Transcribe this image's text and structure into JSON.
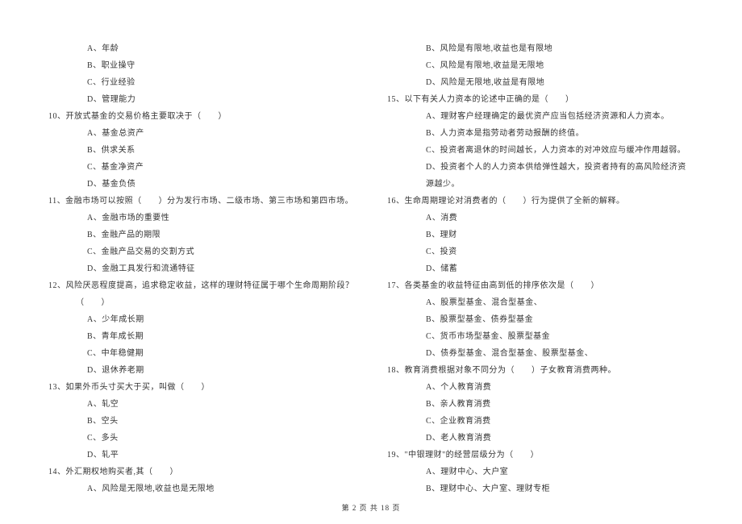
{
  "left_column": {
    "items": [
      {
        "type": "option",
        "text": "A、年龄"
      },
      {
        "type": "option",
        "text": "B、职业操守"
      },
      {
        "type": "option",
        "text": "C、行业经验"
      },
      {
        "type": "option",
        "text": "D、管理能力"
      },
      {
        "type": "question",
        "text": "10、开放式基金的交易价格主要取决于（　　）"
      },
      {
        "type": "option",
        "text": "A、基金总资产"
      },
      {
        "type": "option",
        "text": "B、供求关系"
      },
      {
        "type": "option",
        "text": "C、基金净资产"
      },
      {
        "type": "option",
        "text": "D、基金负债"
      },
      {
        "type": "question",
        "text": "11、金融市场可以按照（　　）分为发行市场、二级市场、第三市场和第四市场。"
      },
      {
        "type": "option",
        "text": "A、金融市场的重要性"
      },
      {
        "type": "option",
        "text": "B、金融产品的期限"
      },
      {
        "type": "option",
        "text": "C、金融产品交易的交割方式"
      },
      {
        "type": "option",
        "text": "D、金融工具发行和流通特征"
      },
      {
        "type": "question",
        "text": "12、风险厌恶程度提高，追求稳定收益，这样的理财特征属于哪个生命周期阶段？（　　）"
      },
      {
        "type": "option",
        "text": "A、少年成长期"
      },
      {
        "type": "option",
        "text": "B、青年成长期"
      },
      {
        "type": "option",
        "text": "C、中年稳健期"
      },
      {
        "type": "option",
        "text": "D、退休养老期"
      },
      {
        "type": "question",
        "text": "13、如果外币头寸买大于买，叫做（　　）"
      },
      {
        "type": "option",
        "text": "A、轧空"
      },
      {
        "type": "option",
        "text": "B、空头"
      },
      {
        "type": "option",
        "text": "C、多头"
      },
      {
        "type": "option",
        "text": "D、轧平"
      },
      {
        "type": "question",
        "text": "14、外汇期权地购买者,其（　　）"
      },
      {
        "type": "option",
        "text": "A、风险是无限地,收益也是无限地"
      }
    ]
  },
  "right_column": {
    "items": [
      {
        "type": "option",
        "text": "B、风险是有限地,收益也是有限地"
      },
      {
        "type": "option",
        "text": "C、风险是有限地,收益是无限地"
      },
      {
        "type": "option",
        "text": "D、风险是无限地,收益是有限地"
      },
      {
        "type": "question",
        "text": "15、以下有关人力资本的论述中正确的是（　　）"
      },
      {
        "type": "option",
        "text": "A、理财客户经理确定的最优资产应当包括经济资源和人力资本。"
      },
      {
        "type": "option",
        "text": "B、人力资本是指劳动者劳动报酬的终值。"
      },
      {
        "type": "option",
        "text": "C、投资者离退休的时间越长，人力资本的对冲效应与缓冲作用越弱。"
      },
      {
        "type": "option",
        "text": "D、投资者个人的人力资本供给弹性越大，投资者持有的高风险经济资源越少。"
      },
      {
        "type": "question",
        "text": "16、生命周期理论对消费者的（　　）行为提供了全新的解释。"
      },
      {
        "type": "option",
        "text": "A、消费"
      },
      {
        "type": "option",
        "text": "B、理财"
      },
      {
        "type": "option",
        "text": "C、投资"
      },
      {
        "type": "option",
        "text": "D、储蓄"
      },
      {
        "type": "question",
        "text": "17、各类基金的收益特征由高到低的排序依次是（　　）"
      },
      {
        "type": "option",
        "text": "A、股票型基金、混合型基金、"
      },
      {
        "type": "option",
        "text": "B、股票型基金、债券型基金"
      },
      {
        "type": "option",
        "text": "C、货币市场型基金、股票型基金"
      },
      {
        "type": "option",
        "text": "D、债券型基金、混合型基金、股票型基金、"
      },
      {
        "type": "question",
        "text": "18、教育消费根据对象不同分为（　　）子女教育消费两种。"
      },
      {
        "type": "option",
        "text": "A、个人教育消费"
      },
      {
        "type": "option",
        "text": "B、亲人教育消费"
      },
      {
        "type": "option",
        "text": "C、企业教育消费"
      },
      {
        "type": "option",
        "text": "D、老人教育消费"
      },
      {
        "type": "question",
        "text": "19、\"中银理财\"的经营层级分为（　　）"
      },
      {
        "type": "option",
        "text": "A、理财中心、大户室"
      },
      {
        "type": "option",
        "text": "B、理财中心、大户室、理财专柜"
      }
    ]
  },
  "footer": {
    "text": "第 2 页 共 18 页"
  }
}
